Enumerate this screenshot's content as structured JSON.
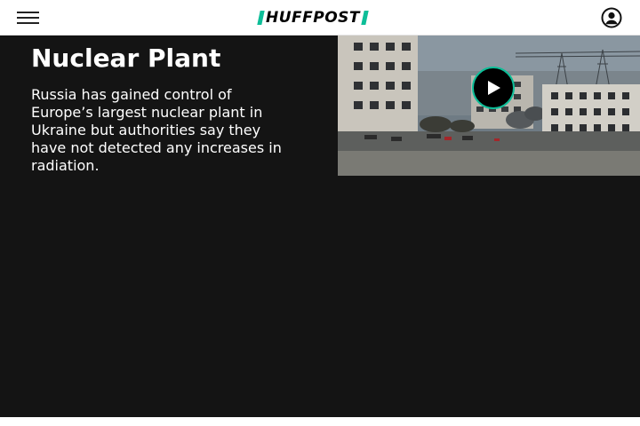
{
  "header": {
    "menu_icon": "hamburger-menu-icon",
    "logo_text": "HUFFPOST",
    "account_icon": "user-account-icon",
    "brand_color": "#0dbe98"
  },
  "article": {
    "headline": "Nuclear Plant",
    "summary": "Russia has gained control of Europe’s largest nuclear plant in Ukraine but authorities say they have not detected any increases in radiation."
  },
  "video": {
    "play_icon": "play-icon",
    "thumbnail_icon": "video-thumbnail"
  },
  "colors": {
    "content_background": "#141414",
    "header_background": "#ffffff",
    "text": "#ffffff"
  }
}
